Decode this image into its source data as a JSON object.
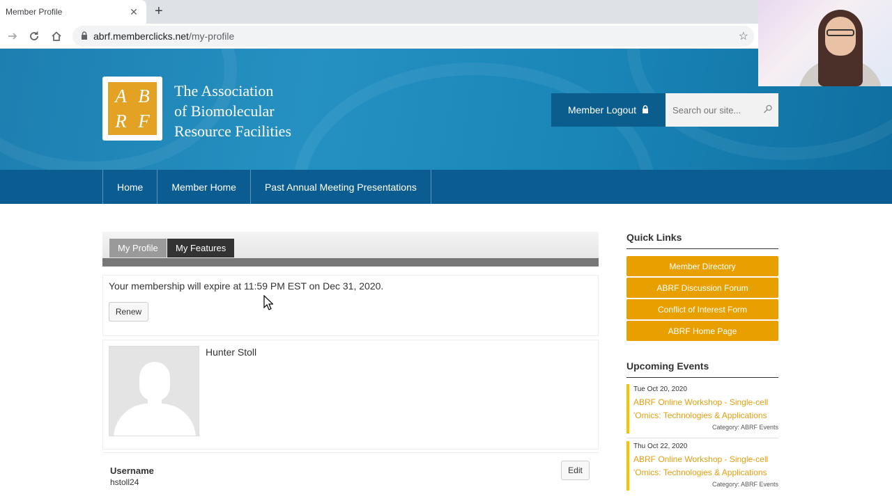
{
  "browser": {
    "tab_title": "Member Profile",
    "tab_close_icon": "close-icon",
    "new_tab_icon": "plus-icon",
    "url_domain": "abrf.memberclicks.net",
    "url_path": "/my-profile"
  },
  "header": {
    "logo_letters": [
      "A",
      "B",
      "R",
      "F"
    ],
    "org_name_line1": "The Association",
    "org_name_line2": "of Biomolecular",
    "org_name_line3": "Resource Facilities",
    "logout_label": "Member Logout",
    "search_placeholder": "Search our site..."
  },
  "nav": {
    "items": [
      "Home",
      "Member Home",
      "Past Annual Meeting Presentations"
    ]
  },
  "profile_tabs": {
    "my_profile": "My Profile",
    "my_features": "My Features"
  },
  "membership": {
    "expiry_text": "Your membership will expire at 11:59 PM EST on Dec 31, 2020.",
    "renew_label": "Renew"
  },
  "profile": {
    "name": "Hunter Stoll",
    "username_label": "Username",
    "username_value": "hstoll24",
    "edit_label": "Edit"
  },
  "sidebar": {
    "quick_links_heading": "Quick Links",
    "quick_links": [
      "Member Directory",
      "ABRF Discussion Forum",
      "Conflict of Interest Form",
      "ABRF Home Page"
    ],
    "events_heading": "Upcoming Events",
    "events": [
      {
        "date": "Tue Oct 20, 2020",
        "title": "ABRF Online Workshop - Single-cell 'Omics: Technologies & Applications",
        "category": "Category: ABRF Events"
      },
      {
        "date": "Thu Oct 22, 2020",
        "title": "ABRF Online Workshop - Single-cell 'Omics: Technologies & Applications",
        "category": "Category: ABRF Events"
      }
    ]
  },
  "colors": {
    "header_blue": "#1d7fb0",
    "nav_blue": "#0b5d91",
    "quick_link_orange": "#e8a000",
    "event_accent": "#f5c400"
  }
}
